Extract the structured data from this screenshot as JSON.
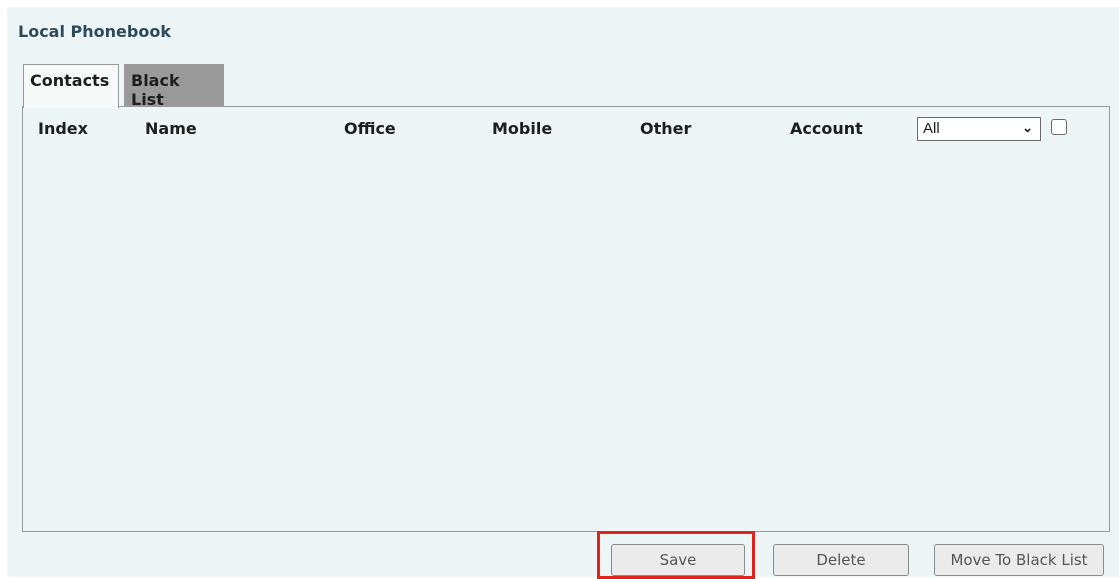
{
  "section_title": "Local Phonebook",
  "tabs": [
    {
      "label": "Contacts",
      "active": true
    },
    {
      "label": "Black List",
      "active": false
    }
  ],
  "table": {
    "columns": [
      "Index",
      "Name",
      "Office",
      "Mobile",
      "Other",
      "Account"
    ],
    "rows": []
  },
  "account_filter": {
    "selected": "All"
  },
  "buttons": {
    "save": "Save",
    "delete": "Delete",
    "move_to_black_list": "Move To Black List"
  },
  "colors": {
    "page_background": "#eef5f6",
    "inactive_tab": "#9a9a9a",
    "highlight": "#e0231b"
  }
}
